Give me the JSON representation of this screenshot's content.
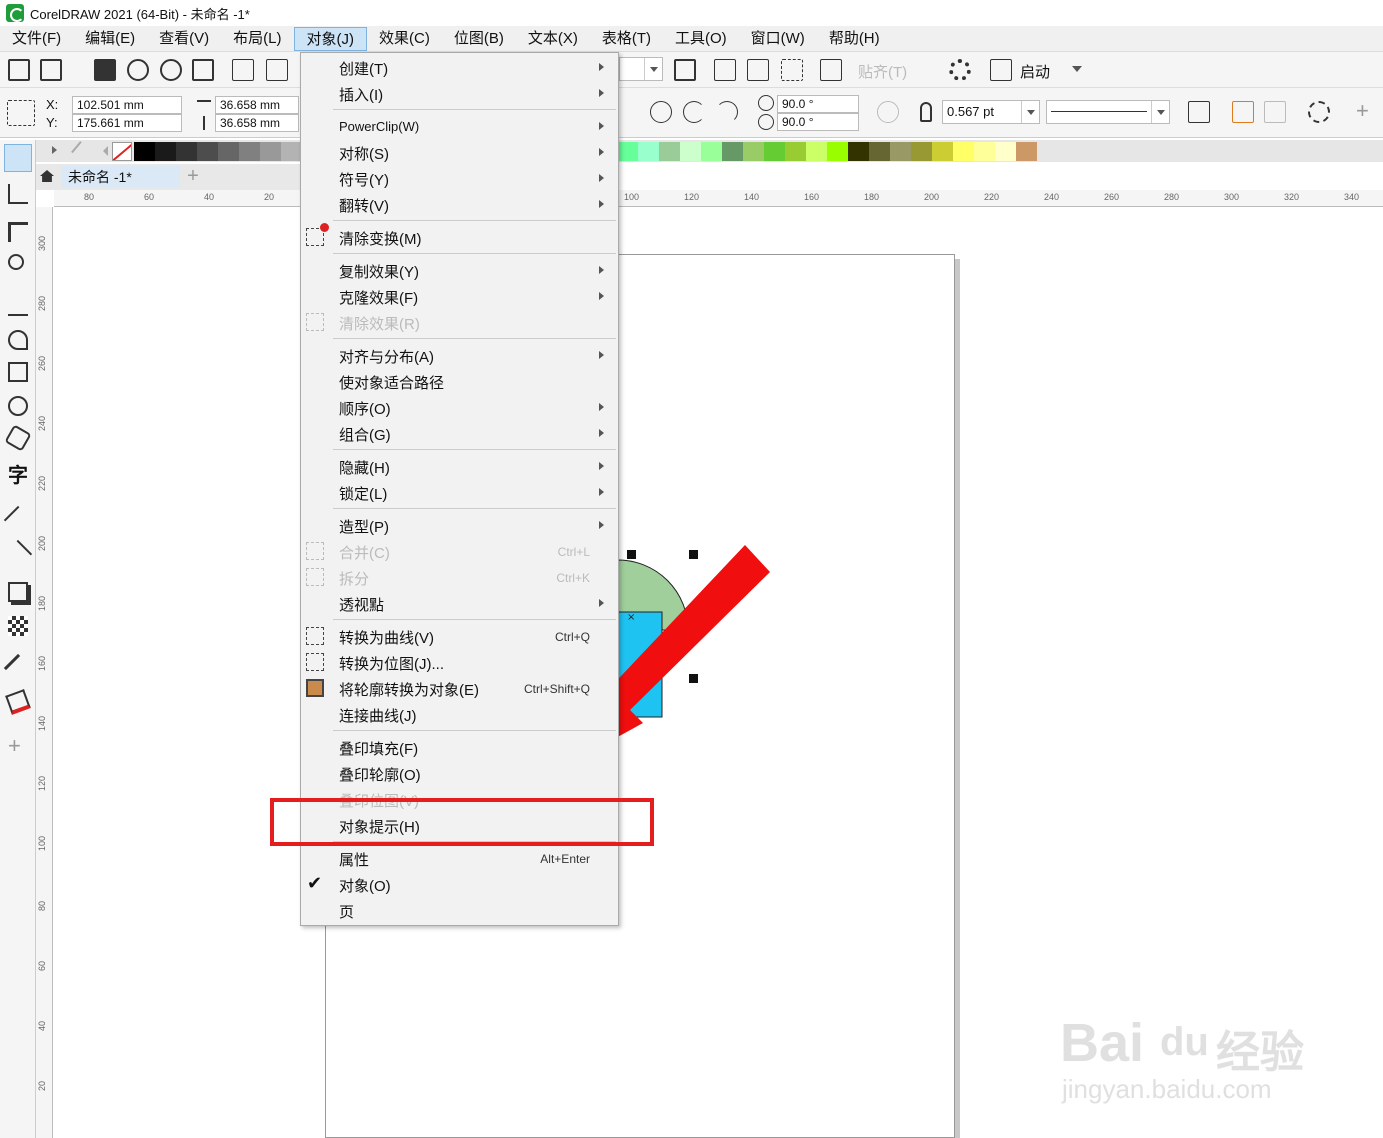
{
  "window": {
    "title": "CorelDRAW 2021 (64-Bit) - 未命名 -1*"
  },
  "menubar": [
    {
      "id": "file",
      "label": "文件(F)"
    },
    {
      "id": "edit",
      "label": "编辑(E)"
    },
    {
      "id": "view",
      "label": "查看(V)"
    },
    {
      "id": "layout",
      "label": "布局(L)"
    },
    {
      "id": "object",
      "label": "对象(J)",
      "active": true
    },
    {
      "id": "effects",
      "label": "效果(C)"
    },
    {
      "id": "bitmaps",
      "label": "位图(B)"
    },
    {
      "id": "text",
      "label": "文本(X)"
    },
    {
      "id": "table",
      "label": "表格(T)"
    },
    {
      "id": "tools",
      "label": "工具(O)"
    },
    {
      "id": "window",
      "label": "窗口(W)"
    },
    {
      "id": "help",
      "label": "帮助(H)"
    }
  ],
  "toolbar": {
    "snap_label": "贴齐(T)",
    "launch_label": "启动"
  },
  "property_bar": {
    "x_label": "X:",
    "y_label": "Y:",
    "x_value": "102.501 mm",
    "y_value": "175.661 mm",
    "width_value": "36.658 mm",
    "height_value": "36.658 mm",
    "start_angle": "90.0 °",
    "end_angle": "90.0 °",
    "outline_width": "0.567 pt"
  },
  "palette": {
    "colors": [
      "#000000",
      "#1a1a1a",
      "#333333",
      "#4d4d4d",
      "#666666",
      "#808080",
      "#999999",
      "#b3b3b3",
      "#6666ff",
      "#3333cc",
      "#003399",
      "#000066",
      "#336699",
      "#00ccff",
      "#66ccff",
      "#99cccc",
      "#669999",
      "#336666",
      "#003333",
      "#006633",
      "#009933",
      "#33cc66",
      "#66cc66",
      "#66ff99",
      "#99ffcc",
      "#99cc99",
      "#ccffcc",
      "#99ff99",
      "#669966",
      "#99cc66",
      "#66cc33",
      "#99cc33",
      "#ccff66",
      "#99ff00",
      "#333300",
      "#666633",
      "#999966",
      "#999933",
      "#cccc33",
      "#ffff66",
      "#ffff99",
      "#ffffcc",
      "#cc9966"
    ]
  },
  "document": {
    "tab_title": "未命名 -1*"
  },
  "ruler": {
    "h_ticks": [
      "80",
      "60",
      "40",
      "20",
      "100",
      "120",
      "140",
      "160",
      "180",
      "200",
      "220",
      "240",
      "260",
      "280",
      "300",
      "320",
      "340"
    ],
    "v_ticks": [
      "300",
      "280",
      "260",
      "240",
      "220",
      "200",
      "180",
      "160",
      "140",
      "120",
      "100",
      "80",
      "60",
      "40",
      "20"
    ]
  },
  "object_menu": {
    "items": [
      {
        "label": "创建(T)",
        "sub": true
      },
      {
        "label": "插入(I)",
        "sub": true
      },
      {
        "label": "PowerClip(W)",
        "sub": true
      },
      {
        "label": "对称(S)",
        "sub": true
      },
      {
        "label": "符号(Y)",
        "sub": true
      },
      {
        "label": "翻转(V)",
        "sub": true
      },
      {
        "label": "清除变换(M)"
      },
      {
        "label": "复制效果(Y)",
        "sub": true
      },
      {
        "label": "克隆效果(F)",
        "sub": true
      },
      {
        "label": "清除效果(R)",
        "disabled": true
      },
      {
        "label": "对齐与分布(A)",
        "sub": true
      },
      {
        "label": "使对象适合路径"
      },
      {
        "label": "顺序(O)",
        "sub": true
      },
      {
        "label": "组合(G)",
        "sub": true
      },
      {
        "label": "隐藏(H)",
        "sub": true
      },
      {
        "label": "锁定(L)",
        "sub": true
      },
      {
        "label": "造型(P)",
        "sub": true
      },
      {
        "label": "合并(C)",
        "shortcut": "Ctrl+L",
        "disabled": true
      },
      {
        "label": "拆分",
        "shortcut": "Ctrl+K",
        "disabled": true
      },
      {
        "label": "透视點",
        "sub": true
      },
      {
        "label": "转换为曲线(V)",
        "shortcut": "Ctrl+Q"
      },
      {
        "label": "转换为位图(J)..."
      },
      {
        "label": "将轮廓转换为对象(E)",
        "shortcut": "Ctrl+Shift+Q"
      },
      {
        "label": "连接曲线(J)"
      },
      {
        "label": "叠印填充(F)"
      },
      {
        "label": "叠印轮廓(O)"
      },
      {
        "label": "叠印位图(V)",
        "disabled": true
      },
      {
        "label": "对象提示(H)",
        "highlighted": true
      },
      {
        "label": "属性",
        "shortcut": "Alt+Enter"
      },
      {
        "label": "对象(O)",
        "checked": true
      },
      {
        "label": "页"
      }
    ]
  },
  "watermark": {
    "brand": "Bai",
    "brand_mid": "du",
    "brand_cn": "经验",
    "url": "jingyan.baidu.com"
  },
  "colors": {
    "accent": "#e41d1d",
    "menu_active": "#cde4f7",
    "shape_green": "#a0cf9b",
    "shape_cyan": "#1ec3f2"
  }
}
